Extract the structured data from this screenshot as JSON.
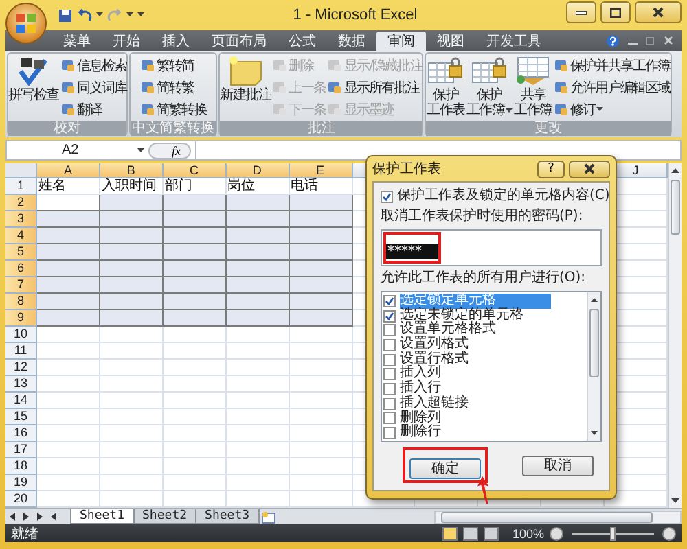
{
  "window": {
    "title": "1 - Microsoft Excel"
  },
  "tabs": [
    {
      "label": "菜单",
      "selected": false
    },
    {
      "label": "开始",
      "selected": false
    },
    {
      "label": "插入",
      "selected": false
    },
    {
      "label": "页面布局",
      "selected": false
    },
    {
      "label": "公式",
      "selected": false
    },
    {
      "label": "数据",
      "selected": false
    },
    {
      "label": "审阅",
      "selected": true
    },
    {
      "label": "视图",
      "selected": false
    },
    {
      "label": "开发工具",
      "selected": false
    }
  ],
  "ribbon": {
    "groups": [
      {
        "label": "校对",
        "items": [
          {
            "kind": "large",
            "lines": [
              "拼写检查"
            ],
            "disabled": false,
            "menu": false
          },
          {
            "kind": "stack",
            "buttons": [
              {
                "label": "信息检索",
                "disabled": false,
                "menu": false
              },
              {
                "label": "同义词库",
                "disabled": false,
                "menu": false
              },
              {
                "label": "翻译",
                "disabled": false,
                "menu": false
              }
            ]
          }
        ]
      },
      {
        "label": "中文简繁转换",
        "items": [
          {
            "kind": "stack",
            "buttons": [
              {
                "label": "繁转简",
                "disabled": false,
                "menu": false
              },
              {
                "label": "简转繁",
                "disabled": false,
                "menu": false
              },
              {
                "label": "简繁转换",
                "disabled": false,
                "menu": false
              }
            ]
          }
        ]
      },
      {
        "label": "批注",
        "items": [
          {
            "kind": "large",
            "lines": [
              "新建批注"
            ],
            "disabled": false,
            "menu": false
          },
          {
            "kind": "stack",
            "buttons": [
              {
                "label": "删除",
                "disabled": true,
                "menu": false
              },
              {
                "label": "上一条",
                "disabled": true,
                "menu": false
              },
              {
                "label": "下一条",
                "disabled": true,
                "menu": false
              }
            ]
          },
          {
            "kind": "stack",
            "buttons": [
              {
                "label": "显示/隐藏批注",
                "disabled": true,
                "menu": false
              },
              {
                "label": "显示所有批注",
                "disabled": false,
                "menu": false
              },
              {
                "label": "显示墨迹",
                "disabled": true,
                "menu": false
              }
            ]
          }
        ]
      },
      {
        "label": "更改",
        "items": [
          {
            "kind": "large",
            "lines": [
              "保护",
              "工作表"
            ],
            "disabled": false,
            "menu": false
          },
          {
            "kind": "large",
            "lines": [
              "保护",
              "工作簿"
            ],
            "disabled": false,
            "menu": true
          },
          {
            "kind": "large",
            "lines": [
              "共享",
              "工作簿"
            ],
            "disabled": false,
            "menu": false
          },
          {
            "kind": "stack",
            "buttons": [
              {
                "label": "保护并共享工作簿",
                "disabled": false,
                "menu": false
              },
              {
                "label": "允许用户编辑区域",
                "disabled": false,
                "menu": false
              },
              {
                "label": "修订",
                "disabled": false,
                "menu": true
              }
            ]
          }
        ]
      }
    ]
  },
  "formula_bar": {
    "name_box": "A2",
    "function_button": "fx"
  },
  "sheet": {
    "columns": [
      {
        "label": "A",
        "selected": true
      },
      {
        "label": "B",
        "selected": true
      },
      {
        "label": "C",
        "selected": true
      },
      {
        "label": "D",
        "selected": true
      },
      {
        "label": "E",
        "selected": true
      },
      {},
      {},
      {},
      {},
      {
        "label": "J",
        "selected": false
      }
    ],
    "rows": [
      {
        "header": "1",
        "selected": false,
        "active": false,
        "cells": [
          "姓名",
          "入职时间",
          "部门",
          "岗位",
          "电话"
        ]
      },
      {
        "header": "2",
        "selected": true,
        "active": true
      },
      {
        "header": "3",
        "selected": true,
        "active": false
      },
      {
        "header": "4",
        "selected": true,
        "active": false
      },
      {
        "header": "5",
        "selected": true,
        "active": false
      },
      {
        "header": "6",
        "selected": true,
        "active": false
      },
      {
        "header": "7",
        "selected": true,
        "active": false
      },
      {
        "header": "8",
        "selected": true,
        "active": false
      },
      {
        "header": "9",
        "selected": true,
        "active": false
      },
      {
        "header": "10",
        "selected": false,
        "active": false
      },
      {
        "header": "11",
        "selected": false,
        "active": false
      },
      {
        "header": "12",
        "selected": false,
        "active": false
      },
      {
        "header": "13",
        "selected": false,
        "active": false
      },
      {
        "header": "14",
        "selected": false,
        "active": false
      },
      {
        "header": "15",
        "selected": false,
        "active": false
      },
      {
        "header": "16",
        "selected": false,
        "active": false
      },
      {
        "header": "17",
        "selected": false,
        "active": false
      },
      {
        "header": "18",
        "selected": false,
        "active": false
      },
      {
        "header": "19",
        "selected": false,
        "active": false
      },
      {
        "header": "20",
        "selected": false,
        "active": false
      }
    ]
  },
  "sheet_tabs": [
    {
      "label": "Sheet1",
      "selected": true
    },
    {
      "label": "Sheet2",
      "selected": false
    },
    {
      "label": "Sheet3",
      "selected": false
    }
  ],
  "status_bar": {
    "text": "就绪",
    "zoom": "100%",
    "zoom_level": {
      "level": 0.5
    }
  },
  "dialog": {
    "title": "保护工作表",
    "help": "?",
    "protect": {
      "label": "保护工作表及锁定的单元格内容(C)",
      "checked": true
    },
    "password_label": "取消工作表保护时使用的密码(P):",
    "password": "*****",
    "password_annotated": true,
    "permissions_label": "允许此工作表的所有用户进行(O):",
    "permissions": [
      {
        "label": "选定锁定单元格",
        "checked": true,
        "selected": true
      },
      {
        "label": "选定未锁定的单元格",
        "checked": true,
        "selected": false
      },
      {
        "label": "设置单元格格式",
        "checked": false,
        "selected": false
      },
      {
        "label": "设置列格式",
        "checked": false,
        "selected": false
      },
      {
        "label": "设置行格式",
        "checked": false,
        "selected": false
      },
      {
        "label": "插入列",
        "checked": false,
        "selected": false
      },
      {
        "label": "插入行",
        "checked": false,
        "selected": false
      },
      {
        "label": "插入超链接",
        "checked": false,
        "selected": false
      },
      {
        "label": "删除列",
        "checked": false,
        "selected": false
      },
      {
        "label": "删除行",
        "checked": false,
        "selected": false
      }
    ],
    "buttons": [
      {
        "label": "确定",
        "kind": "ok",
        "annotated": true
      },
      {
        "label": "取消",
        "kind": "cancel",
        "annotated": false
      }
    ]
  }
}
